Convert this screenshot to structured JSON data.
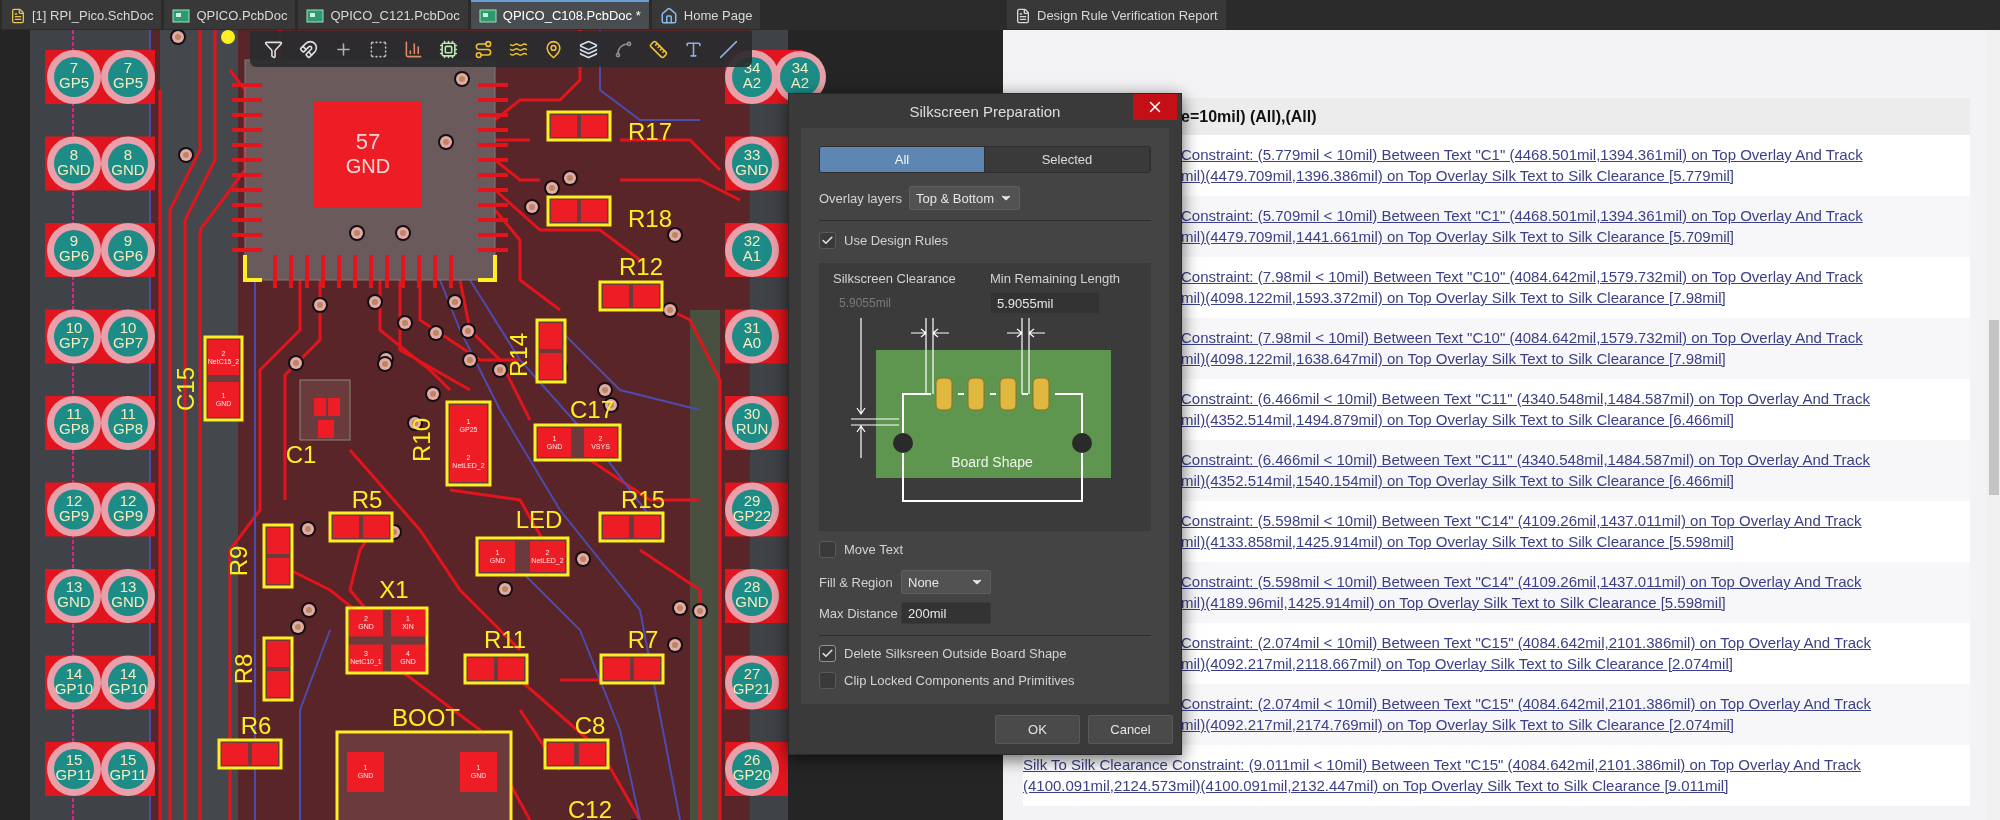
{
  "tabs": [
    {
      "label": "[1] RPI_Pico.SchDoc",
      "kind": "schematic",
      "selected": false
    },
    {
      "label": "QPICO.PcbDoc",
      "kind": "pcb",
      "selected": false
    },
    {
      "label": "QPICO_C121.PcbDoc",
      "kind": "pcb",
      "selected": false
    },
    {
      "label": "QPICO_C108.PcbDoc *",
      "kind": "pcb",
      "selected": true
    },
    {
      "label": "Home Page",
      "kind": "home",
      "selected": false
    }
  ],
  "report_tab": {
    "label": "Design Rule Verification Report"
  },
  "pcb": {
    "left_pins": [
      {
        "pads": [
          {
            "number": "7",
            "name": "GP5"
          },
          {
            "number": "7",
            "name": "GP5"
          }
        ]
      },
      {
        "pads": [
          {
            "number": "8",
            "name": "GND"
          },
          {
            "number": "8",
            "name": "GND"
          }
        ]
      },
      {
        "pads": [
          {
            "number": "9",
            "name": "GP6"
          },
          {
            "number": "9",
            "name": "GP6"
          }
        ]
      },
      {
        "pads": [
          {
            "number": "10",
            "name": "GP7"
          },
          {
            "number": "10",
            "name": "GP7"
          }
        ]
      },
      {
        "pads": [
          {
            "number": "11",
            "name": "GP8"
          },
          {
            "number": "11",
            "name": "GP8"
          }
        ]
      },
      {
        "pads": [
          {
            "number": "12",
            "name": "GP9"
          },
          {
            "number": "12",
            "name": "GP9"
          }
        ]
      },
      {
        "pads": [
          {
            "number": "13",
            "name": "GND"
          },
          {
            "number": "13",
            "name": "GND"
          }
        ]
      },
      {
        "pads": [
          {
            "number": "14",
            "name": "GP10"
          },
          {
            "number": "14",
            "name": "GP10"
          }
        ]
      },
      {
        "pads": [
          {
            "number": "15",
            "name": "GP11"
          },
          {
            "number": "15",
            "name": "GP11"
          }
        ]
      }
    ],
    "right_pins": [
      {
        "pads": [
          {
            "number": "34",
            "name": "A2"
          },
          {
            "number": "34",
            "name": "A2"
          }
        ]
      },
      {
        "pads": [
          {
            "number": "33",
            "name": "GND"
          }
        ]
      },
      {
        "pads": [
          {
            "number": "32",
            "name": "A1"
          }
        ]
      },
      {
        "pads": [
          {
            "number": "31",
            "name": "A0"
          }
        ]
      },
      {
        "pads": [
          {
            "number": "30",
            "name": "RUN"
          }
        ]
      },
      {
        "pads": [
          {
            "number": "29",
            "name": "GP22"
          }
        ]
      },
      {
        "pads": [
          {
            "number": "28",
            "name": "GND"
          }
        ]
      },
      {
        "pads": [
          {
            "number": "27",
            "name": "GP21"
          }
        ]
      },
      {
        "pads": [
          {
            "number": "26",
            "name": "GP20"
          }
        ]
      }
    ],
    "chip_pad": {
      "number": "57",
      "name": "GND"
    },
    "components": [
      {
        "designator": "R17"
      },
      {
        "designator": "R18"
      },
      {
        "designator": "R12"
      },
      {
        "designator": "R14"
      },
      {
        "designator": "C15",
        "pads": [
          {
            "number": "2",
            "net": "NetC15_2"
          },
          {
            "number": "1",
            "net": "GND"
          }
        ]
      },
      {
        "designator": "C17",
        "pads": [
          {
            "number": "1",
            "net": "GND"
          },
          {
            "number": "2",
            "net": "VSYS"
          }
        ]
      },
      {
        "designator": "C1"
      },
      {
        "designator": "R10",
        "pads": [
          {
            "number": "1",
            "net": "GP25"
          },
          {
            "number": "2",
            "net": "NetLED_2"
          }
        ]
      },
      {
        "designator": "R5"
      },
      {
        "designator": "LED",
        "pads": [
          {
            "number": "1",
            "net": "GND"
          },
          {
            "number": "2",
            "net": "NetLED_2"
          }
        ]
      },
      {
        "designator": "R15"
      },
      {
        "designator": "R9"
      },
      {
        "designator": "X1",
        "pads": [
          {
            "number": "2",
            "net": "GND"
          },
          {
            "number": "1",
            "net": "XIN"
          },
          {
            "number": "3",
            "net": "NetC10_1"
          },
          {
            "number": "4",
            "net": "GND"
          }
        ]
      },
      {
        "designator": "R11"
      },
      {
        "designator": "R7"
      },
      {
        "designator": "R8"
      },
      {
        "designator": "BOOT",
        "pads": [
          {
            "number": "1",
            "net": "GND"
          },
          {
            "number": "1",
            "net": "GND"
          }
        ]
      },
      {
        "designator": "R6"
      },
      {
        "designator": "C8"
      },
      {
        "designator": "C12"
      }
    ]
  },
  "dialog": {
    "title": "Silkscreen Preparation",
    "scope_tabs": [
      {
        "label": "All",
        "selected": true
      },
      {
        "label": "Selected",
        "selected": false
      }
    ],
    "overlay_layers": {
      "label": "Overlay layers",
      "value": "Top & Bottom"
    },
    "use_design_rules": {
      "label": "Use Design Rules",
      "checked": true
    },
    "clearance": {
      "label": "Silkscreen Clearance",
      "value": "5.9055mil",
      "disabled": true
    },
    "min_length": {
      "label": "Min Remaining Length",
      "value": "5.9055mil"
    },
    "diagram": {
      "label": "Board Shape"
    },
    "move_text": {
      "label": "Move Text",
      "checked": false
    },
    "fill_region": {
      "label": "Fill & Region",
      "value": "None"
    },
    "max_distance": {
      "label": "Max Distance",
      "value": "200mil"
    },
    "options": [
      {
        "label": "Delete Silksreen Outside Board Shape",
        "checked": true,
        "focused": true
      },
      {
        "label": "Clip Locked Components and Primitives",
        "checked": false,
        "focused": false
      }
    ],
    "buttons": [
      {
        "label": "OK"
      },
      {
        "label": "Cancel"
      }
    ]
  },
  "report": {
    "header": "e=10mil) (All),(All)",
    "header_covered": true,
    "rows": [
      {
        "covered": true,
        "lines": [
          "Constraint: (5.779mil < 10mil) Between Text \"C1\" (4468.501mil,1394.361mil) on Top Overlay And Track",
          "mil)(4479.709mil,1396.386mil) on Top Overlay Silk Text to Silk Clearance [5.779mil]"
        ]
      },
      {
        "covered": true,
        "lines": [
          "Constraint: (5.709mil < 10mil) Between Text \"C1\" (4468.501mil,1394.361mil) on Top Overlay And Track",
          "mil)(4479.709mil,1441.661mil) on Top Overlay Silk Text to Silk Clearance [5.709mil]"
        ]
      },
      {
        "covered": true,
        "lines": [
          "Constraint: (7.98mil < 10mil) Between Text \"C10\" (4084.642mil,1579.732mil) on Top Overlay And Track",
          "mil)(4098.122mil,1593.372mil) on Top Overlay Silk Text to Silk Clearance [7.98mil]"
        ]
      },
      {
        "covered": true,
        "lines": [
          "Constraint: (7.98mil < 10mil) Between Text \"C10\" (4084.642mil,1579.732mil) on Top Overlay And Track",
          "mil)(4098.122mil,1638.647mil) on Top Overlay Silk Text to Silk Clearance [7.98mil]"
        ]
      },
      {
        "covered": true,
        "lines": [
          "Constraint: (6.466mil < 10mil) Between Text \"C11\" (4340.548mil,1484.587mil) on Top Overlay And Track",
          "mil)(4352.514mil,1494.879mil) on Top Overlay Silk Text to Silk Clearance [6.466mil]"
        ]
      },
      {
        "covered": true,
        "lines": [
          "Constraint: (6.466mil < 10mil) Between Text \"C11\" (4340.548mil,1484.587mil) on Top Overlay And Track",
          "mil)(4352.514mil,1540.154mil) on Top Overlay Silk Text to Silk Clearance [6.466mil]"
        ]
      },
      {
        "covered": true,
        "lines": [
          "Constraint: (5.598mil < 10mil) Between Text \"C14\" (4109.26mil,1437.011mil) on Top Overlay And Track",
          "mil)(4133.858mil,1425.914mil) on Top Overlay Silk Text to Silk Clearance [5.598mil]"
        ]
      },
      {
        "covered": true,
        "lines": [
          "Constraint: (5.598mil < 10mil) Between Text \"C14\" (4109.26mil,1437.011mil) on Top Overlay And Track",
          "mil)(4189.96mil,1425.914mil) on Top Overlay Silk Text to Silk Clearance [5.598mil]"
        ]
      },
      {
        "covered": true,
        "lines": [
          "Constraint: (2.074mil < 10mil) Between Text \"C15\" (4084.642mil,2101.386mil) on Top Overlay And Track",
          "mil)(4092.217mil,2118.667mil) on Top Overlay Silk Text to Silk Clearance [2.074mil]"
        ]
      },
      {
        "covered": true,
        "lines": [
          "Constraint: (2.074mil < 10mil) Between Text \"C15\" (4084.642mil,2101.386mil) on Top Overlay And Track",
          "mil)(4092.217mil,2174.769mil) on Top Overlay Silk Text to Silk Clearance [2.074mil]"
        ]
      },
      {
        "covered": false,
        "lines": [
          "Silk To Silk Clearance Constraint: (9.011mil < 10mil) Between Text \"C15\" (4084.642mil,2101.386mil) on Top Overlay And Track",
          "(4100.091mil,2124.573mil)(4100.091mil,2132.447mil) on Top Overlay Silk Text to Silk Clearance [9.011mil]"
        ]
      }
    ]
  }
}
